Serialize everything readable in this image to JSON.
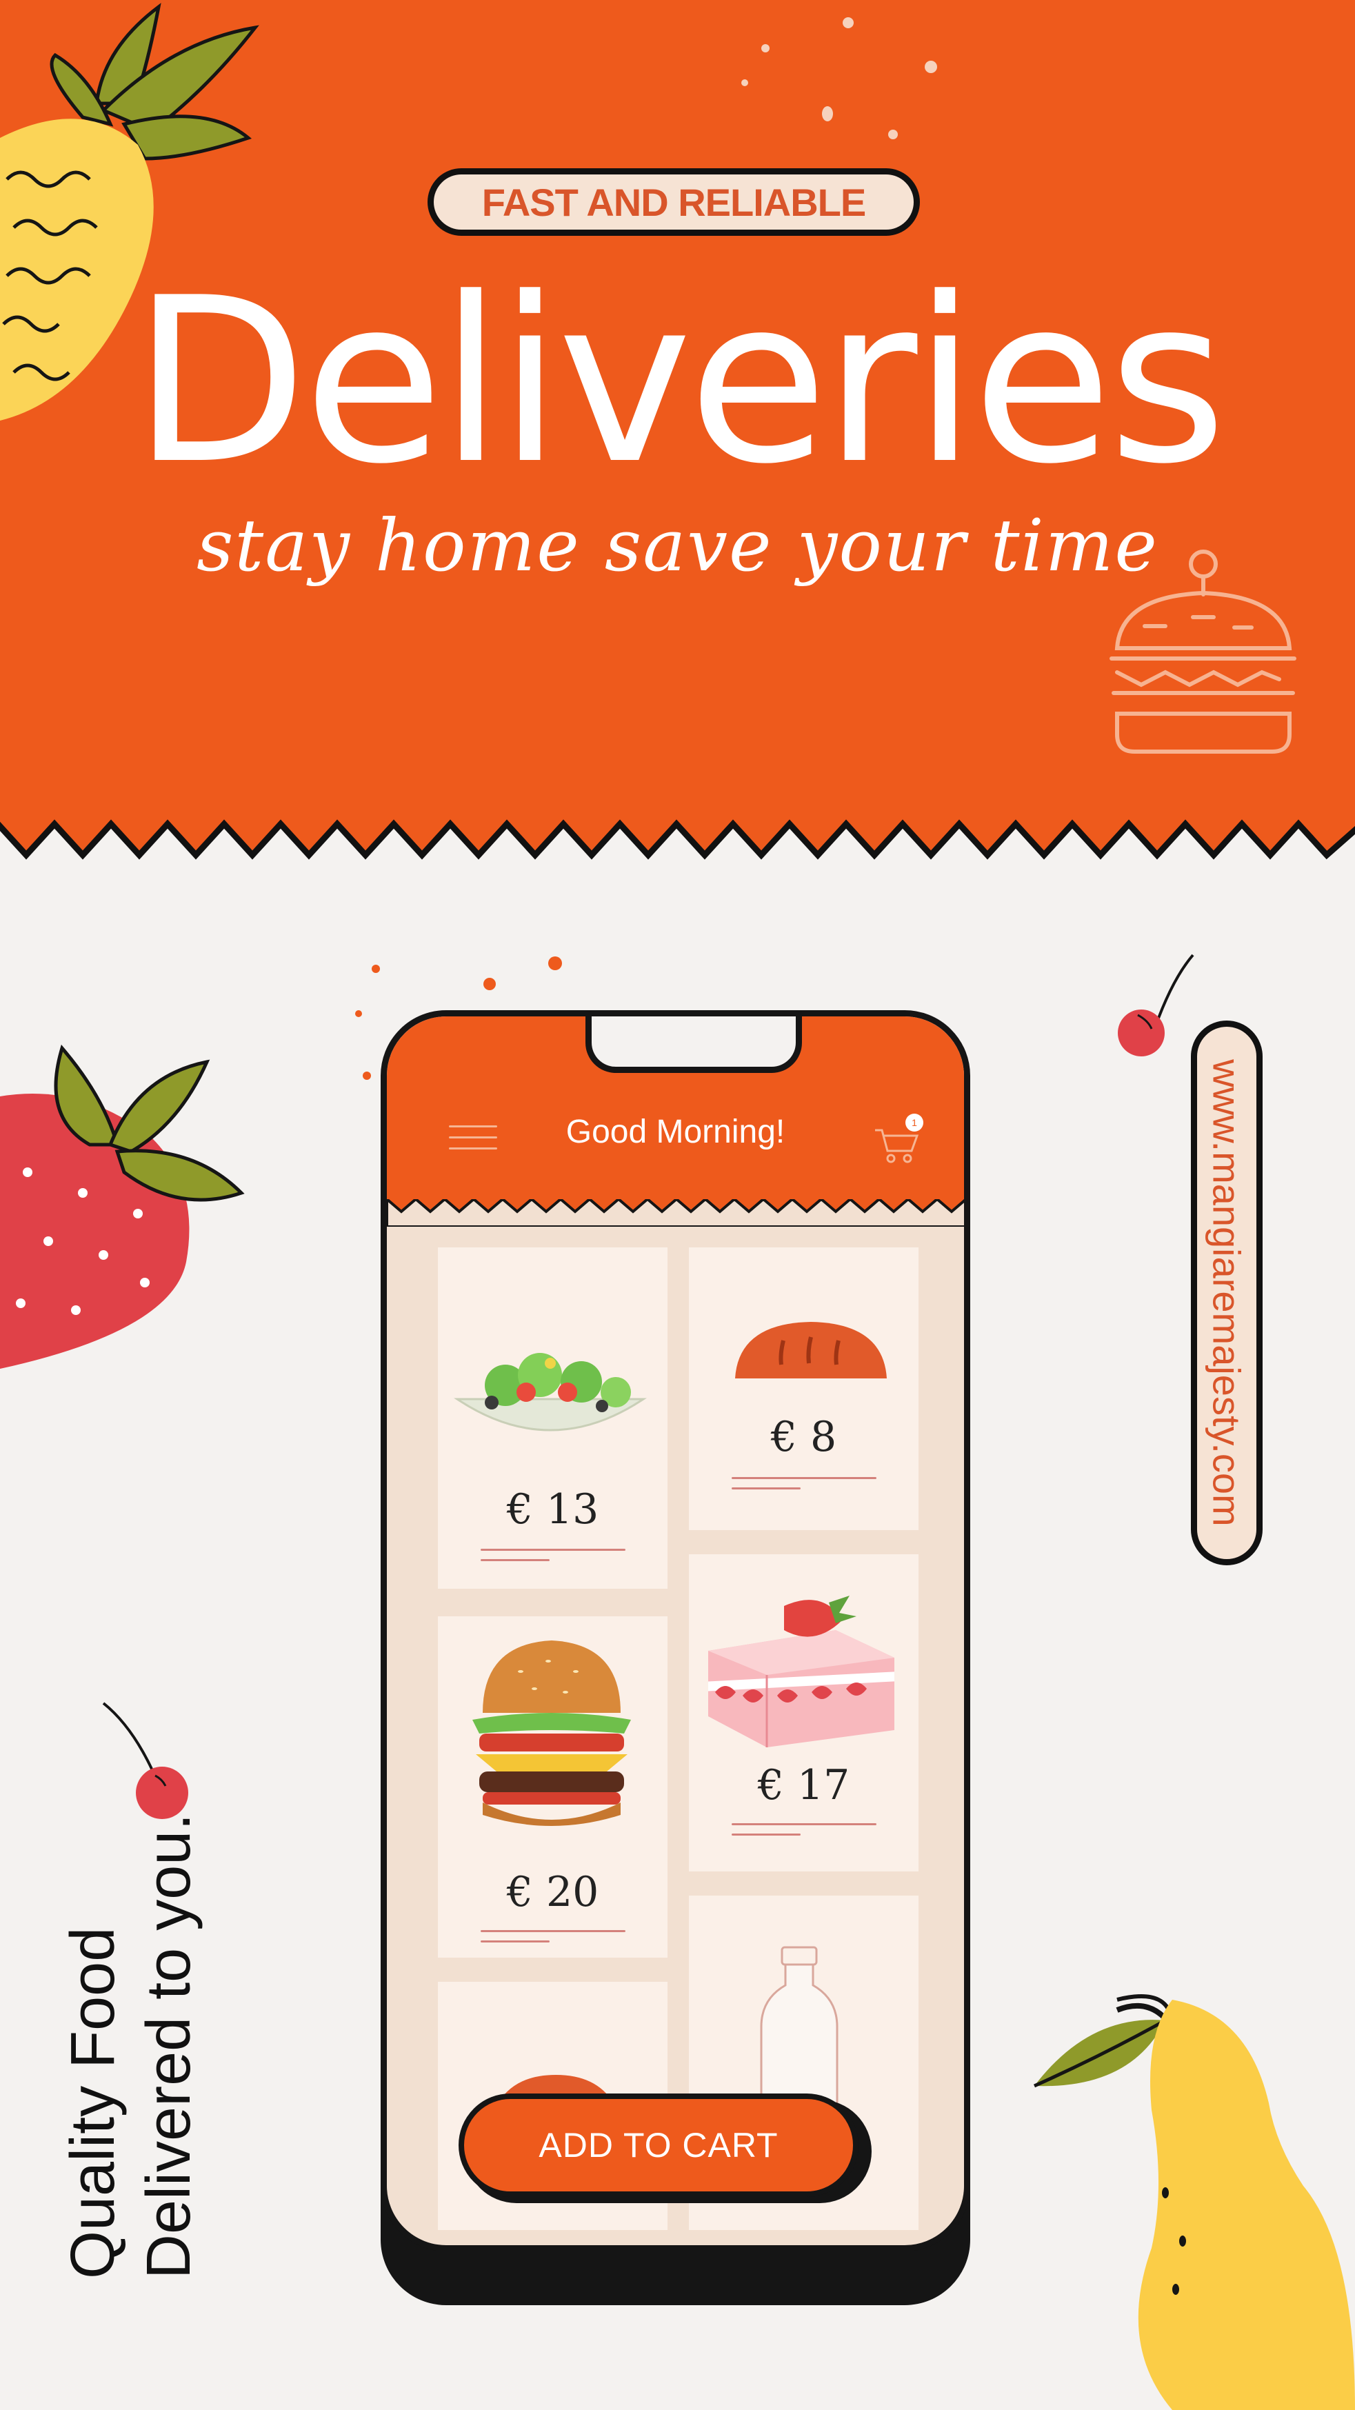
{
  "banner": {
    "badge": "FAST AND RELIABLE",
    "headline": "Deliveries",
    "tagline": "stay home save your time"
  },
  "phone": {
    "greeting": "Good Morning!",
    "cart_count": "1",
    "products": [
      {
        "icon": "salad-bowl-icon",
        "price": "€ 13"
      },
      {
        "icon": "bread-loaf-icon",
        "price": "€ 8"
      },
      {
        "icon": "burger-icon",
        "price": "€ 20"
      },
      {
        "icon": "strawberry-cake-icon",
        "price": "€ 17"
      },
      {
        "icon": "bun-icon"
      },
      {
        "icon": "milk-bottle-icon"
      }
    ],
    "add_to_cart": "ADD TO CART"
  },
  "website": "www.mangiaremajesty.com",
  "slogan": {
    "line1": "Quality Food",
    "line2": "Delivered to you."
  },
  "colors": {
    "primary": "#ee5a1c",
    "cream": "#f6e3d4",
    "background": "#f4f2f0",
    "outline": "#151515"
  }
}
